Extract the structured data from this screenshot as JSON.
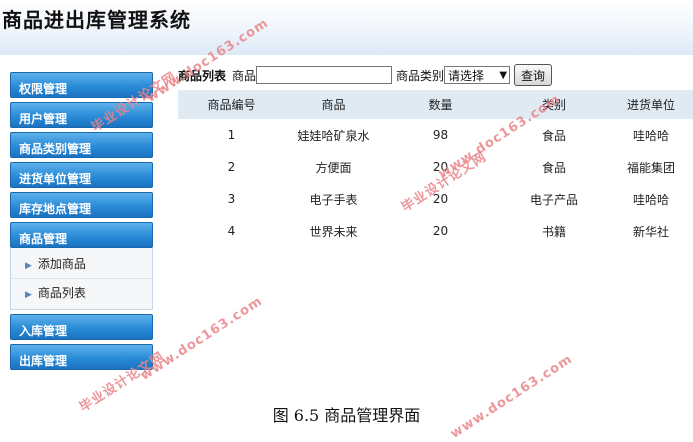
{
  "app": {
    "title": "商品进出库管理系统"
  },
  "sidebar": {
    "items": [
      {
        "label": "权限管理"
      },
      {
        "label": "用户管理"
      },
      {
        "label": "商品类别管理"
      },
      {
        "label": "进货单位管理"
      },
      {
        "label": "库存地点管理"
      }
    ],
    "group": {
      "label": "商品管理",
      "children": [
        {
          "label": "添加商品"
        },
        {
          "label": "商品列表"
        }
      ]
    },
    "tail_items": [
      {
        "label": "入库管理"
      },
      {
        "label": "出库管理"
      }
    ]
  },
  "search": {
    "section_title": "商品列表",
    "product_label": "商品",
    "product_value": "",
    "category_label": "商品类别",
    "category_selected": "请选择",
    "query_button": "查询"
  },
  "table": {
    "headers": [
      "商品编号",
      "商品",
      "数量",
      "类别",
      "进货单位"
    ],
    "rows": [
      [
        "1",
        "娃娃哈矿泉水",
        "98",
        "食品",
        "哇哈哈"
      ],
      [
        "2",
        "方便面",
        "20",
        "食品",
        "福能集团"
      ],
      [
        "3",
        "电子手表",
        "20",
        "电子产品",
        "哇哈哈"
      ],
      [
        "4",
        "世界未来",
        "20",
        "书籍",
        "新华社"
      ]
    ]
  },
  "caption": "图 6.5  商品管理界面",
  "watermarks": {
    "text_cn": "毕业设计论文网",
    "text_url": "www.doc163.com",
    "color": "#e9868a"
  }
}
